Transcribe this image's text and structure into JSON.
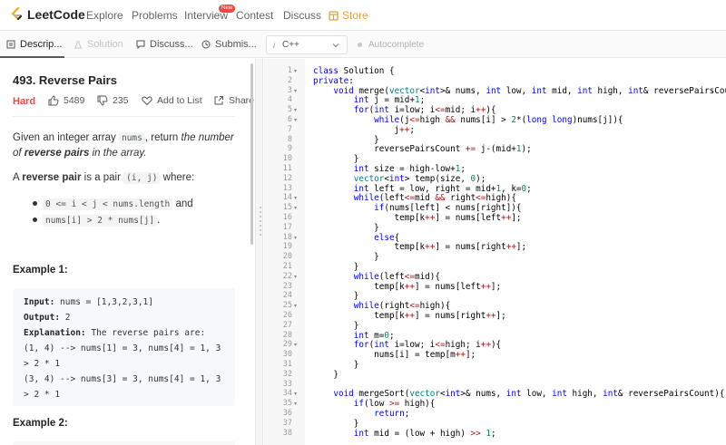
{
  "nav": {
    "brand": "LeetCode",
    "links": [
      "Explore",
      "Problems",
      "Interview",
      "Contest",
      "Discuss",
      "Store"
    ],
    "new_badge": "New"
  },
  "tabs": [
    "Descrip...",
    "Solution",
    "Discuss...",
    "Submis..."
  ],
  "editor_bar": {
    "language": "C++",
    "autocomplete": "Autocomplete"
  },
  "problem": {
    "title": "493. Reverse Pairs",
    "difficulty": "Hard",
    "likes": "5489",
    "dislikes": "235",
    "add_to_list": "Add to List",
    "share": "Share",
    "desc_line1_a": "Given an integer array ",
    "desc_code1": "nums",
    "desc_line1_b": ", return ",
    "desc_line1_c": "the number",
    "desc_line2_a": "of ",
    "desc_line2_b": "reverse pairs",
    "desc_line2_c": " in the array.",
    "desc_line3_a": "A ",
    "desc_line3_b": "reverse pair",
    "desc_line3_c": " is a pair ",
    "desc_code2": "(i, j)",
    "desc_line3_d": " where:",
    "bullet1_code": "0 <= i < j < nums.length",
    "bullet1_text": " and",
    "bullet2_code": "nums[i] > 2 * nums[j]",
    "bullet2_text": ".",
    "example1_heading": "Example 1:",
    "example2_heading": "Example 2:",
    "example1": {
      "input_label": "Input:",
      "input_value": " nums = [1,3,2,3,1]",
      "output_label": "Output:",
      "output_value": " 2",
      "explanation_label": "Explanation:",
      "explanation_value": " The reverse pairs are:",
      "lines": [
        "(1, 4) --> nums[1] = 3, nums[4] = 1, 3",
        "> 2 * 1",
        "(3, 4) --> nums[3] = 3, nums[4] = 1, 3",
        "> 2 * 1"
      ]
    }
  },
  "code": {
    "line_numbers": [
      "1",
      "2",
      "3",
      "4",
      "5",
      "6",
      "7",
      "8",
      "9",
      "10",
      "11",
      "12",
      "13",
      "14",
      "15",
      "16",
      "17",
      "18",
      "19",
      "20",
      "21",
      "22",
      "23",
      "24",
      "25",
      "26",
      "27",
      "28",
      "29",
      "30",
      "31",
      "32",
      "33",
      "34",
      "35",
      "36",
      "37",
      "38"
    ],
    "lines": [
      "class Solution {",
      "private:",
      "    void merge(vector<int>& nums, int low, int mid, int high, int& reversePairsCount){",
      "        int j = mid+1;",
      "        for(int i=low; i<=mid; i++){",
      "            while(j<=high && nums[i] > 2*(long long)nums[j]){",
      "                j++;",
      "            }",
      "            reversePairsCount += j-(mid+1);",
      "        }",
      "        int size = high-low+1;",
      "        vector<int> temp(size, 0);",
      "        int left = low, right = mid+1, k=0;",
      "        while(left<=mid && right<=high){",
      "            if(nums[left] < nums[right]){",
      "                temp[k++] = nums[left++];",
      "            }",
      "            else{",
      "                temp[k++] = nums[right++];",
      "            }",
      "        }",
      "        while(left<=mid){",
      "            temp[k++] = nums[left++];",
      "        }",
      "        while(right<=high){",
      "            temp[k++] = nums[right++];",
      "        }",
      "        int m=0;",
      "        for(int i=low; i<=high; i++){",
      "            nums[i] = temp[m++];",
      "        }",
      "    }",
      "",
      "    void mergeSort(vector<int>& nums, int low, int high, int& reversePairsCount){",
      "        if(low >= high){",
      "            return;",
      "        }",
      "        int mid = (low + high) >> 1;"
    ],
    "fold_lines": [
      1,
      3,
      5,
      6,
      14,
      15,
      18,
      22,
      25,
      29,
      34,
      35
    ]
  },
  "colors": {
    "hard": "#ef4743",
    "store": "#e8a23a",
    "keyword": "#0000ff",
    "type": "#008080"
  }
}
